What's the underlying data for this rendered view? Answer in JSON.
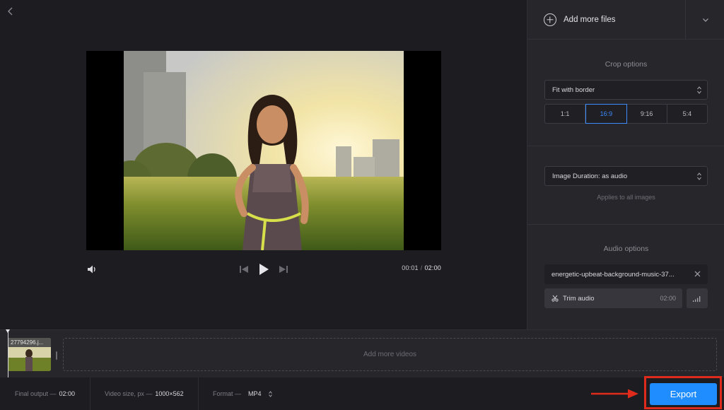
{
  "player": {
    "current_time": "00:01",
    "separator": "/",
    "total_time": "02:00"
  },
  "panel": {
    "add_files_label": "Add more files",
    "crop": {
      "title": "Crop options",
      "mode_value": "Fit with border",
      "ratios": [
        "1:1",
        "16:9",
        "9:16",
        "5:4"
      ],
      "active_ratio": "16:9"
    },
    "duration": {
      "value": "Image Duration: as audio",
      "note": "Applies to all images"
    },
    "audio": {
      "title": "Audio options",
      "file_name": "energetic-upbeat-background-music-37...",
      "trim_label": "Trim audio",
      "trim_duration": "02:00"
    }
  },
  "timeline": {
    "clip_name": "27794296.j...",
    "dropzone_label": "Add more videos"
  },
  "footer": {
    "final_output_label": "Final output —",
    "final_output_value": "02:00",
    "video_size_label": "Video size, px —",
    "video_size_value": "1000×562",
    "format_label": "Format —",
    "format_value": "MP4",
    "export_label": "Export"
  },
  "colors": {
    "accent": "#1f8dff",
    "active_ratio": "#3d8bff",
    "highlight_frame": "#e02a1b",
    "background": "#1c1c21",
    "panel": "#26262b"
  },
  "icons": [
    "back-arrow-icon",
    "volume-icon",
    "skip-back-icon",
    "play-icon",
    "skip-forward-icon",
    "add-circle-icon",
    "chevron-down-icon",
    "up-down-arrows-icon",
    "close-icon",
    "scissors-icon",
    "volume-bars-icon"
  ]
}
